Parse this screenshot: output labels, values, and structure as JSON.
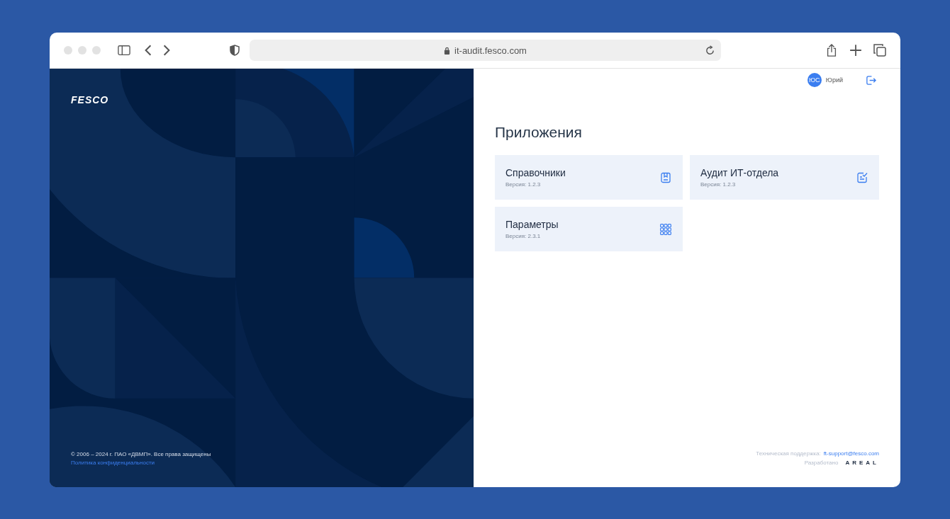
{
  "browser": {
    "url": "it-audit.fesco.com"
  },
  "brand": {
    "logo": "FESCO",
    "copyright": "© 2006 – 2024 г. ПАО «ДВМП». Все права защищены",
    "privacy_link": "Политика конфиденциальности"
  },
  "user": {
    "initials": "ЮС",
    "name": "Юрий"
  },
  "page_title": "Приложения",
  "apps": [
    {
      "title": "Справочники",
      "version": "Версия: 1.2.3",
      "kind": "book"
    },
    {
      "title": "Аудит ИТ-отдела",
      "version": "Версия: 1.2.3",
      "kind": "checklist"
    },
    {
      "title": "Параметры",
      "version": "Версия: 2.3.1",
      "kind": "grid"
    }
  ],
  "footer": {
    "support_label": "Техническая поддержка:",
    "support_email": "ft-support@fesco.com",
    "developed_label": "Разработано",
    "developer_logo": "AREAL"
  }
}
